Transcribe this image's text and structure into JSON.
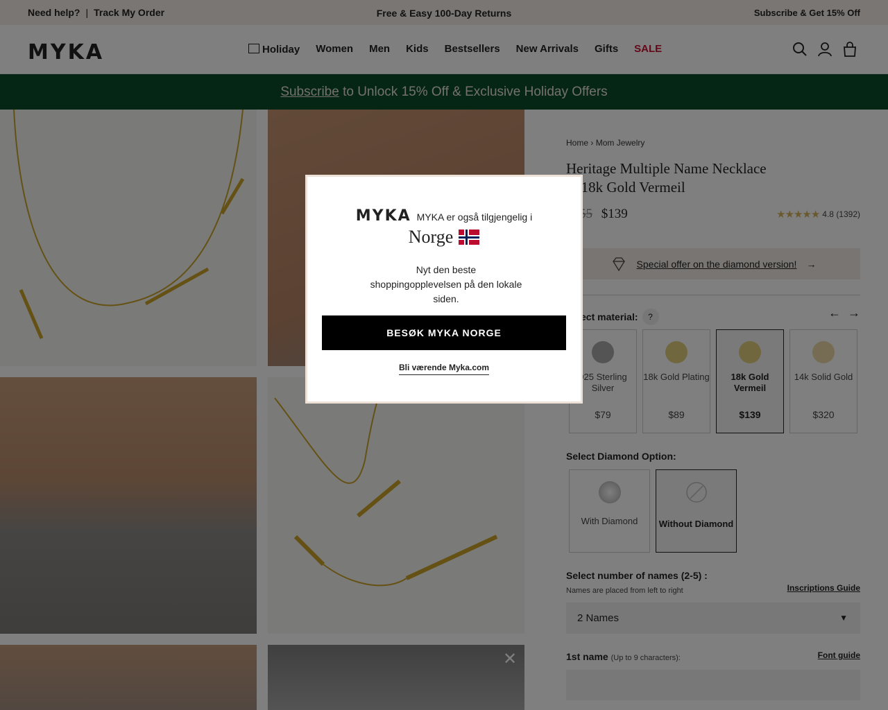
{
  "topbar": {
    "help": "Need help?",
    "separator": "|",
    "track": "Track My Order",
    "center": "Free & Easy 100-Day Returns",
    "subscribe": "Subscribe & Get 15% Off"
  },
  "header": {
    "logo": "MYKA",
    "nav": [
      "Holiday",
      "Women",
      "Men",
      "Kids",
      "Bestsellers",
      "New Arrivals",
      "Gifts",
      "SALE"
    ],
    "icons": [
      "search-icon",
      "account-icon",
      "bag-icon"
    ],
    "sale_color": "#c8102e"
  },
  "promo": {
    "link": "Subscribe",
    "text": " to Unlock 15% Off & Exclusive Holiday Offers",
    "bg_color": "#0b4a2b"
  },
  "product": {
    "breadcrumb_home": "Home",
    "breadcrumb_sep": "›",
    "breadcrumb_cat": "Mom Jewelry",
    "title": "Heritage Multiple Name Necklace in 18k Gold Vermeil",
    "old_price": "$155",
    "price": "$139",
    "stars": "★★★★★",
    "rating": "4.8 (1392)",
    "special_offer": "Special offer on the diamond version!",
    "material_label": "Select material:",
    "material_help": "?",
    "materials": [
      {
        "name": "925 Sterling Silver",
        "price": "$79",
        "color": "#a9a9a9",
        "selected": false
      },
      {
        "name": "18k Gold Plating",
        "price": "$89",
        "color": "#e3cf7f",
        "selected": false
      },
      {
        "name": "18k Gold Vermeil",
        "price": "$139",
        "color": "#e1cf7c",
        "selected": true
      },
      {
        "name": "14k Solid Gold",
        "price": "$320",
        "color": "#ead9a6",
        "selected": false
      }
    ],
    "diamond_label": "Select Diamond Option:",
    "diamonds": [
      {
        "name": "With Diamond",
        "selected": false
      },
      {
        "name": "Without Diamond",
        "selected": true
      }
    ],
    "names_label": "Select number of names (2-5) :",
    "names_note": "Names are placed from left to right",
    "inscriptions_guide": "Inscriptions Guide",
    "names_value": "2 Names",
    "first_name_label": "1st name",
    "first_name_hint": "(Up to 9 characters):",
    "font_guide": "Font guide"
  },
  "modal": {
    "logo": "MYKA",
    "subtitle": "MYKA er også tilgjengelig i",
    "country": "Norge",
    "body": "Nyt den beste shoppingopplevelsen på den lokale siden.",
    "button": "BESØK MYKA NORGE",
    "stay": "Bli værende Myka.com",
    "flag_icon": "norway-flag-icon"
  }
}
